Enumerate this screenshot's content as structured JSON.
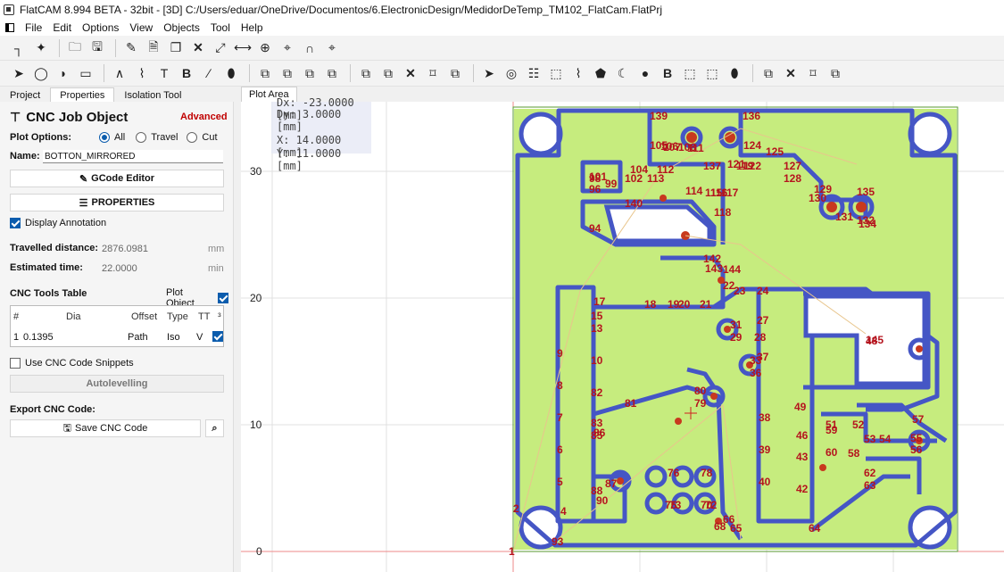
{
  "window": {
    "title": "FlatCAM 8.994 BETA - 32bit - [3D]    C:/Users/eduar/OneDrive/Documentos/6.ElectronicDesign/MedidorDeTemp_TM102_FlatCam.FlatPrj"
  },
  "menu": [
    "File",
    "Edit",
    "Options",
    "View",
    "Objects",
    "Tool",
    "Help"
  ],
  "tabs": {
    "project": "Project",
    "properties": "Properties",
    "isolation": "Isolation Tool",
    "plot_area": "Plot Area"
  },
  "panel": {
    "title": "CNC Job Object",
    "advanced": "Advanced",
    "plot_options_label": "Plot Options:",
    "plot_options": [
      "All",
      "Travel",
      "Cut"
    ],
    "name_label": "Name:",
    "name_value": "BOTTON_MIRRORED",
    "gcode_editor": "GCode Editor",
    "properties_btn": "PROPERTIES",
    "display_annotation": "Display Annotation",
    "travelled_label": "Travelled distance:",
    "travelled_value": "2876.0981",
    "travelled_unit": "mm",
    "estimated_label": "Estimated time:",
    "estimated_value": "22.0000",
    "estimated_unit": "min",
    "tools_table_label": "CNC Tools Table",
    "plot_object": "Plot Object",
    "table_headers": [
      "#",
      "Dia",
      "Offset",
      "Type",
      "TT",
      "³"
    ],
    "table_row": {
      "num": "1",
      "dia": "0.1395",
      "offset": "Path",
      "type": "Iso",
      "tt": "V"
    },
    "snippets": "Use CNC Code Snippets",
    "autolevelling": "Autolevelling",
    "export_label": "Export CNC Code:",
    "save_btn": "Save CNC Code"
  },
  "plot": {
    "dx_line": "Dx:  -23.0000 [mm]",
    "dy_line": "Dy:   3.0000 [mm]",
    "x_line": "X:   14.0000 [mm]",
    "y_line": "Y:   11.0000 [mm]",
    "y_ticks": [
      "30",
      "20",
      "10",
      "0"
    ],
    "annotations": [
      "1",
      "2",
      "4",
      "5",
      "6",
      "7",
      "8",
      "9",
      "10",
      "13",
      "15",
      "17",
      "18",
      "19",
      "20",
      "21",
      "22",
      "23",
      "24",
      "27",
      "28",
      "29",
      "31",
      "33",
      "36",
      "37",
      "38",
      "39",
      "40",
      "42",
      "43",
      "46",
      "48",
      "49",
      "51",
      "52",
      "53",
      "54",
      "55",
      "56",
      "57",
      "58",
      "59",
      "60",
      "62",
      "63",
      "64",
      "65",
      "66",
      "68",
      "70",
      "72",
      "73",
      "75",
      "76",
      "78",
      "79",
      "80",
      "81",
      "82",
      "83",
      "85",
      "86",
      "87",
      "88",
      "90",
      "93",
      "94",
      "96",
      "98",
      "99",
      "101",
      "102",
      "104",
      "105",
      "106",
      "107",
      "108",
      "111",
      "112",
      "113",
      "114",
      "115",
      "116",
      "117",
      "118",
      "119",
      "121",
      "122",
      "124",
      "125",
      "127",
      "128",
      "129",
      "130",
      "131",
      "132",
      "134",
      "135",
      "136",
      "137",
      "139",
      "140",
      "142",
      "143",
      "144",
      "145",
      "148"
    ]
  },
  "colors": {
    "copper": "#c6ec7e",
    "trace": "#4556c5",
    "annotation": "#b5141e",
    "grid": "#e1e1e1"
  }
}
